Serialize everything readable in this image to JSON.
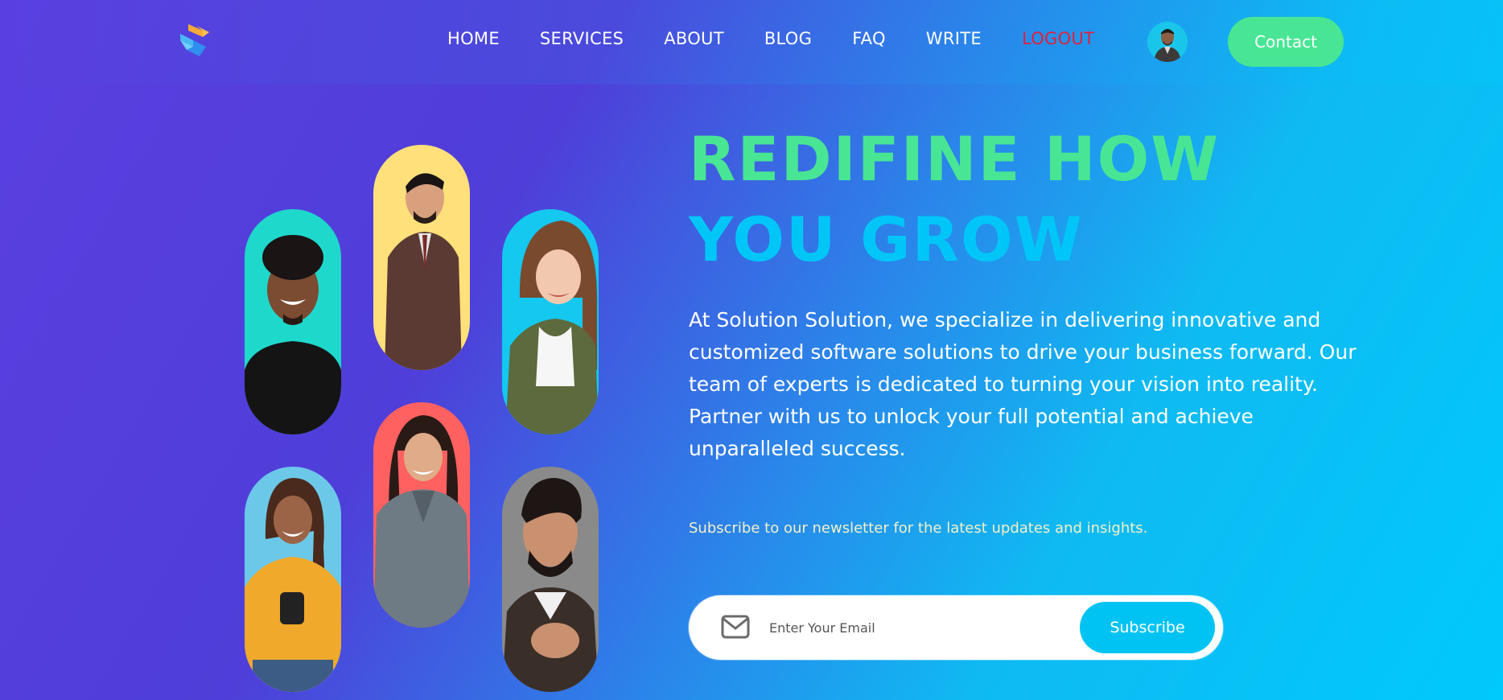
{
  "header": {
    "logo_icon": "s-logo-icon",
    "nav": [
      {
        "label": "HOME"
      },
      {
        "label": "SERVICES"
      },
      {
        "label": "ABOUT"
      },
      {
        "label": "BLOG"
      },
      {
        "label": "FAQ"
      },
      {
        "label": "WRITE"
      },
      {
        "label": "LOGOUT",
        "color": "#e0213d"
      }
    ],
    "avatar_icon": "user-avatar",
    "contact_label": "Contact"
  },
  "hero": {
    "title_line1": "REDIFINE HOW",
    "title_line2": "YOU GROW",
    "description": "At Solution Solution, we specialize in delivering innovative and customized software solutions to drive your business forward. Our team of experts is dedicated to turning your vision into reality. Partner with us to unlock your full potential and achieve unparalleled success.",
    "newsletter_note": "Subscribe to our newsletter for the latest updates and insights.",
    "email_placeholder": "Enter Your Email",
    "subscribe_label": "Subscribe"
  },
  "colors": {
    "green_accent": "#48e694",
    "cyan_accent": "#00c6f7",
    "logout_red": "#e0213d",
    "pill_teal": "#1fd8cc",
    "pill_yellow": "#ffe07a",
    "pill_cyan": "#14c8ef",
    "pill_lightblue": "#6cc8e8",
    "pill_coral": "#ff6161",
    "pill_gray": "#8a8a8a"
  }
}
